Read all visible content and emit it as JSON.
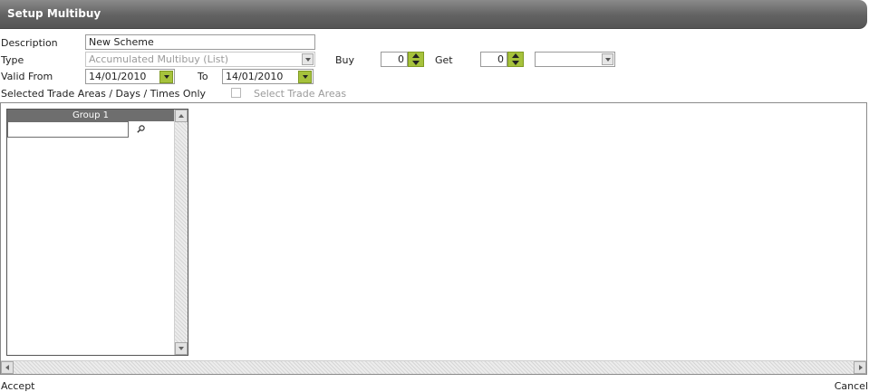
{
  "window": {
    "title": "Setup Multibuy"
  },
  "form": {
    "description_label": "Description",
    "description_value": "New Scheme",
    "type_label": "Type",
    "type_value": "Accumulated Multibuy (List)",
    "buy_label": "Buy",
    "buy_value": "0",
    "get_label": "Get",
    "get_value": "0",
    "get_select_value": "",
    "valid_from_label": "Valid From",
    "valid_from_value": "14/01/2010",
    "to_label": "To",
    "to_value": "14/01/2010",
    "selected_trade_areas_label": "Selected Trade Areas / Days / Times Only",
    "selected_trade_areas_checked": false,
    "select_trade_areas_label": "Select Trade Areas"
  },
  "group_panel": {
    "header": "Group 1",
    "search_value": ""
  },
  "footer": {
    "accept_label": "Accept",
    "cancel_label": "Cancel"
  },
  "icons": {
    "search": "search-icon",
    "dropdown": "chevron-down-icon",
    "spinner": "spinner-icon"
  },
  "colors": {
    "titlebar": "#626262",
    "accent_green": "#a6c23c",
    "disabled_text": "#9a9a9a"
  }
}
